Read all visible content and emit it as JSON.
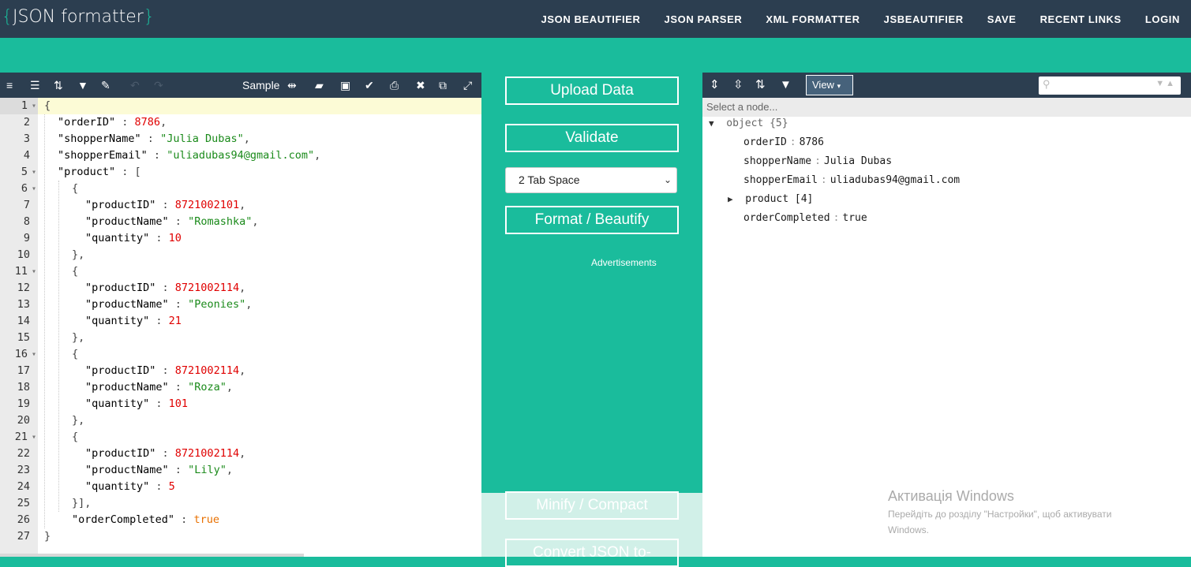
{
  "header": {
    "logo_open": "{",
    "logo_text": "JSON formatter",
    "logo_close": "}",
    "nav": [
      "JSON BEAUTIFIER",
      "JSON PARSER",
      "XML FORMATTER",
      "JSBEAUTIFIER",
      "SAVE",
      "RECENT LINKS",
      "LOGIN"
    ]
  },
  "editor": {
    "sample_label": "Sample",
    "lines": [
      "1",
      "2",
      "3",
      "4",
      "5",
      "6",
      "7",
      "8",
      "9",
      "10",
      "11",
      "12",
      "13",
      "14",
      "15",
      "16",
      "17",
      "18",
      "19",
      "20",
      "21",
      "22",
      "23",
      "24",
      "25",
      "26",
      "27"
    ],
    "tokens": {
      "t2k": "\"orderID\"",
      "t2v": "8786",
      "t3k": "\"shopperName\"",
      "t3v": "\"Julia Dubas\"",
      "t4k": "\"shopperEmail\"",
      "t4v": "\"uliadubas94@gmail.com\"",
      "t5k": "\"product\"",
      "t7k": "\"productID\"",
      "t7v": "8721002101",
      "t8k": "\"productName\"",
      "t8v": "\"Romashka\"",
      "t9k": "\"quantity\"",
      "t9v": "10",
      "t12k": "\"productID\"",
      "t12v": "8721002114",
      "t13k": "\"productName\"",
      "t13v": "\"Peonies\"",
      "t14k": "\"quantity\"",
      "t14v": "21",
      "t17k": "\"productID\"",
      "t17v": "8721002114",
      "t18k": "\"productName\"",
      "t18v": "\"Roza\"",
      "t19k": "\"quantity\"",
      "t19v": "101",
      "t22k": "\"productID\"",
      "t22v": "8721002114",
      "t23k": "\"productName\"",
      "t23v": "\"Lily\"",
      "t24k": "\"quantity\"",
      "t24v": "5",
      "t26k": "\"orderCompleted\"",
      "t26v": "true"
    }
  },
  "middle": {
    "upload": "Upload Data",
    "validate": "Validate",
    "tab_select": "2 Tab Space",
    "format": "Format / Beautify",
    "ads": "Advertisements",
    "minify": "Minify / Compact",
    "convert": "Convert JSON to-"
  },
  "tree": {
    "view_label": "View",
    "crumb": "Select a node...",
    "root_label": "object",
    "root_count": "{5}",
    "rows": [
      {
        "key": "orderID",
        "value": "8786"
      },
      {
        "key": "shopperName",
        "value": "Julia Dubas"
      },
      {
        "key": "shopperEmail",
        "value": "uliadubas94@gmail.com"
      },
      {
        "key": "product",
        "value": "[4]"
      },
      {
        "key": "orderCompleted",
        "value": "true"
      }
    ]
  },
  "watermark": {
    "title": "Активація Windows",
    "text1": "Перейдіть до розділу \"Настройки\", щоб активувати",
    "text2": "Windows."
  }
}
